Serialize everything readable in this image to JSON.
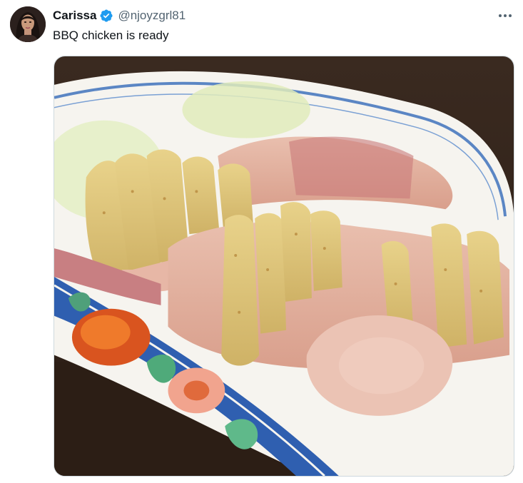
{
  "tweet": {
    "author": {
      "display_name": "Carissa",
      "handle": "@njoyzgrl81",
      "verified": true,
      "verified_color": "#1d9bf0",
      "avatar_icon": "profile-avatar"
    },
    "text": "BBQ chicken is ready",
    "more_icon": "more-horizontal-icon",
    "media": {
      "type": "photo",
      "subject": "sliced chicken on a decorated porcelain plate"
    }
  }
}
